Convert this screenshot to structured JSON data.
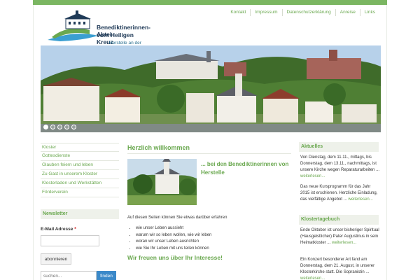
{
  "header": {
    "logo_line1": "Benediktinerinnen-Abtei",
    "logo_line2": "vom Heiligen Kreuz",
    "logo_line3": "Herstelle an der Weser",
    "topnav": [
      "Kontakt",
      "Impressum",
      "Datenschutzerklärung",
      "Anreise",
      "Links"
    ]
  },
  "slider": {
    "dot_count": 5,
    "active_index": 0
  },
  "leftnav": [
    "Kloster",
    "Gottesdienste",
    "Glauben feiern und leben",
    "Zu Gast in unserem Kloster",
    "Klosterladen und Werkstätten",
    "Förderverein"
  ],
  "newsletter": {
    "title": "Newsletter",
    "email_label": "E-Mail Adresse",
    "required_mark": "*",
    "email_value": "",
    "subscribe_label": "abonnieren"
  },
  "search": {
    "placeholder": "suchen...",
    "button_label": "finden"
  },
  "main": {
    "title": "Herzlich willkommen",
    "subtitle": "... bei den Benediktinerinnen von Herstelle",
    "intro": "Auf diesen Seiten können Sie etwas darüber erfahren",
    "bullets": [
      "wie unser Leben aussieht",
      "warum wir so leben wollen, wie wir leben",
      "woran wir unser Leben ausrichten",
      "wie Sie Ihr Leben mit uns teilen können"
    ],
    "closing": "Wir freuen uns über Ihr Interesse!"
  },
  "aktuelles": {
    "title": "Aktuelles",
    "item1": "Von Dienstag, dem 11.11., mittags, bis Donnerstag, dem 13.11., nachmittags, ist unsere Kirche wegen Reparaturarbeiten ...",
    "item2": "Das neue Kursprogramm für das Jahr 2015 ist erschienen. Herzliche Einladung, das vielfältige Angebot ...",
    "more_label": "weiterlesen..."
  },
  "klostertagebuch": {
    "title": "Klostertagebuch",
    "item1": "Ende Oktober ist unser bisheriger Spiritual (Hausgeistlicher) Pater Augustinus in sein Heimatkloster ...",
    "item2": "Ein Konzert besonderer Art fand am Donnerstag, dem 21. August, in unserer Klosterkirche statt. Die Sopranistin ...",
    "more_label": "weiterlesen..."
  },
  "colors": {
    "accent": "#6aa84f",
    "topbar": "#7bb662",
    "logo_blue": "#1f3a57",
    "search_button": "#3b89c9"
  }
}
